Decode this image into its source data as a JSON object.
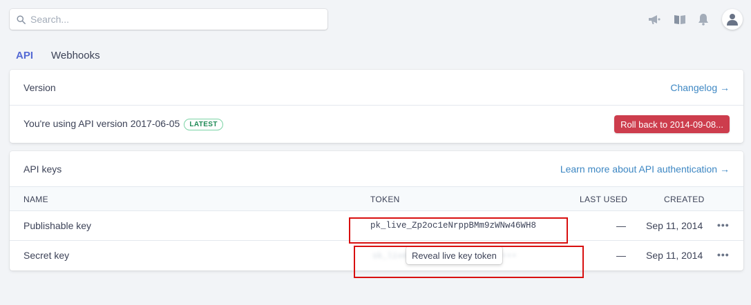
{
  "search": {
    "placeholder": "Search..."
  },
  "top_icons": [
    "megaphone-icon",
    "book-icon",
    "bell-icon",
    "user-icon"
  ],
  "tabs": [
    {
      "label": "API",
      "active": true
    },
    {
      "label": "Webhooks",
      "active": false
    }
  ],
  "version_card": {
    "title": "Version",
    "changelog_link": "Changelog →",
    "current_text": "You're using API version 2017-06-05",
    "badge": "LATEST",
    "rollback_label": "Roll back to 2014-09-08..."
  },
  "keys_card": {
    "title": "API keys",
    "learn_link": "Learn more about API authentication →",
    "columns": {
      "name": "NAME",
      "token": "TOKEN",
      "last_used": "LAST USED",
      "created": "CREATED"
    },
    "rows": [
      {
        "name": "Publishable key",
        "token": "pk_live_Zp2oc1eNrppBMm9zWNw46WH8",
        "last_used": "—",
        "created": "Sep 11, 2014",
        "menu": "•••"
      },
      {
        "name": "Secret key",
        "token": "sk_live_•••••••••••••••••••••",
        "last_used": "—",
        "created": "Sep 11, 2014",
        "menu": "•••",
        "reveal_label": "Reveal live key token"
      }
    ]
  },
  "colors": {
    "accent": "#5469d4",
    "link": "#3d87c3",
    "danger": "#cd3d4d",
    "badge_green": "#1e8a55",
    "annotation_red": "#d80f0f"
  }
}
